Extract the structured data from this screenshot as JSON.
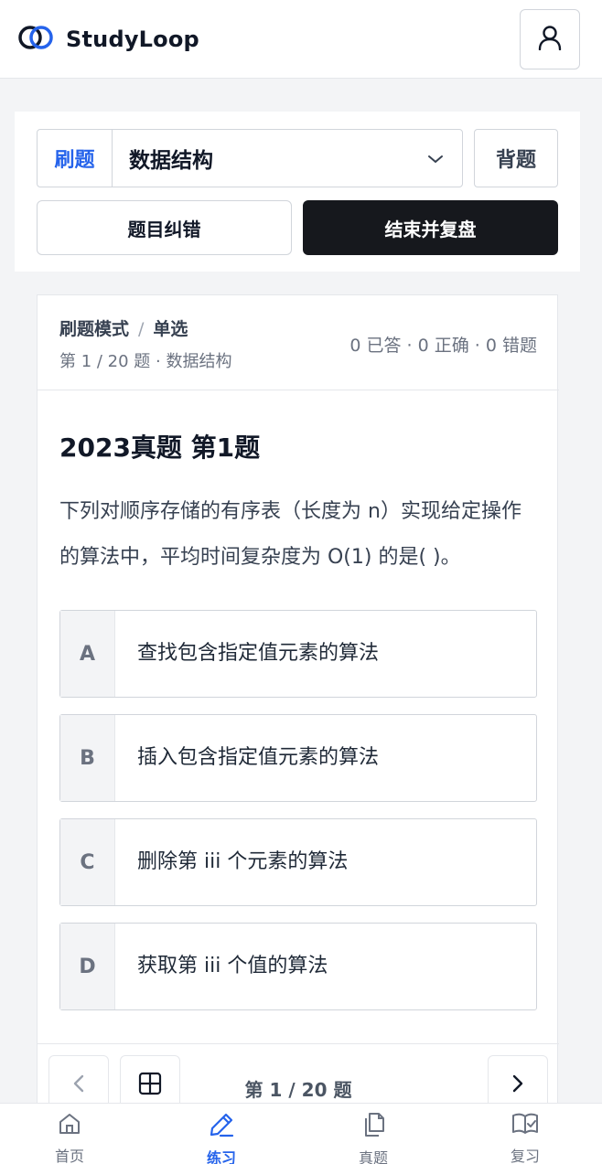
{
  "app": {
    "name": "StudyLoop"
  },
  "practice": {
    "mode_label": "刷题",
    "subject": "数据结构",
    "memorize_label": "背题",
    "correct_label": "题目纠错",
    "finish_label": "结束并复盘"
  },
  "question_header": {
    "mode": "刷题模式",
    "separator": "/",
    "type": "单选",
    "progress": "第 1 / 20 题 · 数据结构",
    "stats": "0 已答 · 0 正确 · 0 错题"
  },
  "question": {
    "title": "2023真题 第1题",
    "text": "下列对顺序存储的有序表（长度为 n）实现给定操作的算法中，平均时间复杂度为 O(1) 的是( )。",
    "options": [
      {
        "letter": "A",
        "text": "查找包含指定值元素的算法"
      },
      {
        "letter": "B",
        "text": "插入包含指定值元素的算法"
      },
      {
        "letter": "C",
        "text": "删除第 iii 个元素的算法"
      },
      {
        "letter": "D",
        "text": "获取第 iii 个值的算法"
      }
    ]
  },
  "pager": {
    "label": "第 1 / 20 题"
  },
  "bottom_nav": [
    {
      "label": "首页",
      "icon": "home-icon"
    },
    {
      "label": "练习",
      "icon": "pencil-icon",
      "active": true
    },
    {
      "label": "真题",
      "icon": "documents-icon"
    },
    {
      "label": "复习",
      "icon": "book-check-icon"
    }
  ],
  "colors": {
    "accent": "#2563eb",
    "dark_button": "#16181d",
    "background": "#f3f4f6"
  }
}
